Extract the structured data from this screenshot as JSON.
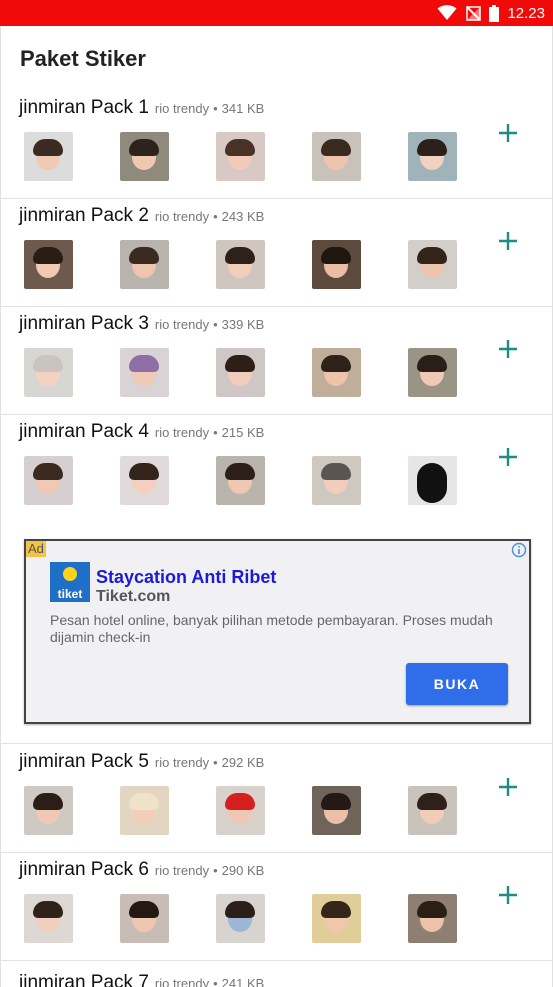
{
  "status_bar": {
    "time": "12.23"
  },
  "page": {
    "title": "Paket Stiker"
  },
  "packs": [
    {
      "name": "jinmiran Pack 1",
      "author": "rio trendy",
      "size": "341 KB"
    },
    {
      "name": "jinmiran Pack 2",
      "author": "rio trendy",
      "size": "243 KB"
    },
    {
      "name": "jinmiran Pack 3",
      "author": "rio trendy",
      "size": "339 KB"
    },
    {
      "name": "jinmiran Pack 4",
      "author": "rio trendy",
      "size": "215 KB"
    },
    {
      "name": "jinmiran Pack 5",
      "author": "rio trendy",
      "size": "292 KB"
    },
    {
      "name": "jinmiran Pack 6",
      "author": "rio trendy",
      "size": "290 KB"
    },
    {
      "name": "jinmiran Pack 7",
      "author": "rio trendy",
      "size": "241 KB"
    }
  ],
  "separator": "•",
  "ad": {
    "badge": "Ad",
    "logo_text": "tiket",
    "title": "Staycation Anti Ribet",
    "site": "Tiket.com",
    "description": "Pesan hotel online, banyak pilihan metode pembayaran. Proses mudah dijamin check-in",
    "cta": "BUKA"
  },
  "colors": {
    "status_bar": "#f00a0a",
    "accent_add": "#1e8c82",
    "ad_title": "#1a1ad8",
    "ad_button": "#2f6ee8"
  },
  "icons": {
    "add": "plus-icon",
    "info": "info-icon",
    "wifi": "wifi-icon",
    "signal": "no-signal-icon",
    "battery": "battery-icon"
  }
}
